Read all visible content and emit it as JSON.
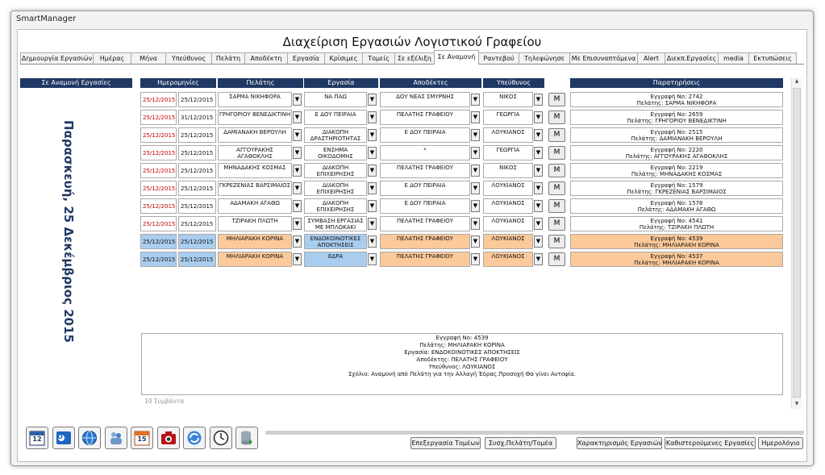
{
  "window": {
    "title": "SmartManager"
  },
  "app_title": "Διαχείριση Εργασιών Λογιστικού Γραφείου",
  "tabs": [
    "Δημιουργία Εργασιών",
    "Ημέρας",
    "Μήνα",
    "Υπεύθυνος",
    "Πελάτη",
    "Αποδέκτη",
    "Εργασία",
    "Κρίσιμες",
    "Τομείς",
    "Σε εξέλιξη",
    "Σε Αναμονή",
    "Ραντεβού",
    "Τηλεφώνησε",
    "Με Επισυναπτόμενα",
    "Alert",
    "Διεκπ.Εργασίες",
    "media",
    "Εκτυπώσεις"
  ],
  "active_tab": "Σε Αναμονή",
  "side": {
    "header": "Σε Αναμονή Εργασίες",
    "date": "Παρασκευή, 25 Δεκέμβριος 2015"
  },
  "headers": {
    "dates": "Ημερομηνίες",
    "customer": "Πελάτης",
    "task": "Εργασία",
    "recipients": "Αποδέκτες",
    "responsible": "Υπεύθυνος",
    "notes": "Παρατηρήσεις"
  },
  "m_label": "M",
  "rows": [
    {
      "d1": "25/12/2015",
      "d2": "25/12/2015",
      "customer": "ΣΑΡΜΑ ΝΙΚΗΦΟΡΑ",
      "task": "ΝΑ ΠΑΩ",
      "recipient": "ΔΟΥ ΝΕΑΣ ΣΜΥΡΝΗΣ",
      "responsible": "ΝΙΚΟΣ",
      "note1": "Εγγραφή Νο: 2742",
      "note2": "Πελάτης: ΣΑΡΜΑ ΝΙΚΗΦΟΡΑ",
      "d1_red": true,
      "selected": false
    },
    {
      "d1": "25/12/2015",
      "d2": "31/12/2015",
      "customer": "ΓΡΗΓΟΡΙΟΥ ΒΕΝΕΔΙΚΤΙΝΗ",
      "task": "Ε ΔΟΥ ΠΕΙΡΑΙΑ",
      "recipient": "ΠΕΛΑΤΗΣ ΓΡΑΦΕΙΟΥ",
      "responsible": "ΓΕΩΡΓΙΑ",
      "note1": "Εγγραφή Νο: 2659",
      "note2": "Πελάτης: ΓΡΗΓΟΡΙΟΥ ΒΕΝΕΔΙΚΤΙΝΗ",
      "d1_red": true,
      "selected": false
    },
    {
      "d1": "25/12/2015",
      "d2": "25/12/2015",
      "customer": "ΔΑΜΙΑΝΑΚΗ ΒΕΡΟΥΛΗ",
      "task": "ΔΙΑΚΟΠΗ ΔΡΑΣΤΗΡΙΟΤΗΤΑΣ",
      "recipient": "Ε ΔΟΥ ΠΕΙΡΑΙΑ",
      "responsible": "ΛΟΥΚΙΑΝΟΣ",
      "note1": "Εγγραφή Νο: 2515",
      "note2": "Πελάτης: ΔΑΜΙΑΝΑΚΗ ΒΕΡΟΥΛΗ",
      "d1_red": true,
      "selected": false
    },
    {
      "d1": "25/12/2015",
      "d2": "25/12/2015",
      "customer": "ΑΓΓΟΥΡΑΚΗΣ ΑΓΑΘΟΚΛΗΣ",
      "task": "ΕΝΣΗΜΑ ΟΙΚΟΔΟΜΗΣ",
      "recipient": "*",
      "responsible": "ΓΕΩΡΓΙΑ",
      "note1": "Εγγραφή Νο: 2220",
      "note2": "Πελάτης: ΑΓΓΟΥΡΑΚΗΣ ΑΓΑΘΟΚΛΗΣ",
      "d1_red": true,
      "selected": false
    },
    {
      "d1": "25/12/2015",
      "d2": "25/12/2015",
      "customer": "ΜΗΝΑΔΑΚΗΣ ΚΟΣΜΑΣ",
      "task": "ΔΙΑΚΟΠΗ ΕΠΙΧΕΙΡΗΣΗΣ",
      "recipient": "ΠΕΛΑΤΗΣ ΓΡΑΦΕΙΟΥ",
      "responsible": "ΝΙΚΟΣ",
      "note1": "Εγγραφή Νο: 2219",
      "note2": "Πελάτης: ΜΗΝΑΔΑΚΗΣ ΚΟΣΜΑΣ",
      "d1_red": true,
      "selected": false
    },
    {
      "d1": "25/12/2015",
      "d2": "25/12/2015",
      "customer": "ΓΚΡΕΖΕΝΙΑΣ ΒΑΡΣΙΜΑΙΟΣ",
      "task": "ΔΙΑΚΟΠΗ ΕΠΙΧΕΙΡΗΣΗΣ",
      "recipient": "Ε ΔΟΥ ΠΕΙΡΑΙΑ",
      "responsible": "ΛΟΥΚΙΑΝΟΣ",
      "note1": "Εγγραφή Νο: 1579",
      "note2": "Πελάτης: ΓΚΡΕΖΕΝΙΑΣ ΒΑΡΣΙΜΑΙΟΣ",
      "d1_red": true,
      "selected": false
    },
    {
      "d1": "25/12/2015",
      "d2": "25/12/2015",
      "customer": "ΑΔΑΜΑΚΗ ΑΓΑΘΩ",
      "task": "ΔΙΑΚΟΠΗ ΕΠΙΧΕΙΡΗΣΗΣ",
      "recipient": "Ε ΔΟΥ ΠΕΙΡΑΙΑ",
      "responsible": "ΛΟΥΚΙΑΝΟΣ",
      "note1": "Εγγραφή Νο: 1578",
      "note2": "Πελάτης: ΑΔΑΜΑΚΗ ΑΓΑΘΩ",
      "d1_red": true,
      "selected": false
    },
    {
      "d1": "25/12/2015",
      "d2": "25/12/2015",
      "customer": "ΤΖΙΡΑΚΗ ΠΛΩΤΗ",
      "task": "ΣΥΜΒΑΣΗ ΕΡΓΑΣΙΑΣ ΜΕ ΜΠΛΟΚΑΚΙ",
      "recipient": "ΠΕΛΑΤΗΣ ΓΡΑΦΕΙΟΥ",
      "responsible": "ΛΟΥΚΙΑΝΟΣ",
      "note1": "Εγγραφή Νο: 4541",
      "note2": "Πελάτης: ΤΖΙΡΑΚΗ ΠΛΩΤΗ",
      "d1_red": true,
      "selected": false
    },
    {
      "d1": "25/12/2015",
      "d2": "25/12/2015",
      "customer": "ΜΗΛΙΑΡΑΚΗ ΚΟΡΙΝΑ",
      "task": "ΕΝΔΟΚΟΙΝΟΤΙΚΕΣ ΑΠΟΚΤΗΣΕΙΣ",
      "recipient": "ΠΕΛΑΤΗΣ ΓΡΑΦΕΙΟΥ",
      "responsible": "ΛΟΥΚΙΑΝΟΣ",
      "note1": "Εγγραφή Νο: 4539",
      "note2": "Πελάτης: ΜΗΛΙΑΡΑΚΗ ΚΟΡΙΝΑ",
      "d1_red": false,
      "selected": true
    },
    {
      "d1": "25/12/2015",
      "d2": "25/12/2015",
      "customer": "ΜΗΛΙΑΡΑΚΗ ΚΟΡΙΝΑ",
      "task": "ΕΔΡΑ",
      "recipient": "ΠΕΛΑΤΗΣ ΓΡΑΦΕΙΟΥ",
      "responsible": "ΛΟΥΚΙΑΝΟΣ",
      "note1": "Εγγραφή Νο: 4537",
      "note2": "Πελάτης: ΜΗΛΙΑΡΑΚΗ ΚΟΡΙΝΑ",
      "d1_red": false,
      "selected": true
    }
  ],
  "detail": {
    "lines": [
      "Εγγραφή Νο: 4539",
      "Πελάτης: ΜΗΛΙΑΡΑΚΗ ΚΟΡΙΝΑ",
      "Εργασία: ΕΝΔΟΚΟΙΝΟΤΙΚΕΣ ΑΠΟΚΤΗΣΕΙΣ",
      "Αποδέκτης: ΠΕΛΑΤΗΣ ΓΡΑΦΕΙΟΥ",
      "Υπεύθυνος: ΛΟΥΚΙΑΝΟΣ",
      "Σχόλιο: Αναμονή από Πελάτη για την Αλλαγή Έδρας.Προσοχή Θα γίνει Αυτοψία."
    ]
  },
  "count_text": "10 Συμβάντα",
  "toolbar_icons": [
    {
      "name": "calendar-icon",
      "label": "12"
    },
    {
      "name": "outlook-icon",
      "label": "O"
    },
    {
      "name": "globe-icon",
      "label": ""
    },
    {
      "name": "users-icon",
      "label": ""
    },
    {
      "name": "date-15-icon",
      "label": "15"
    },
    {
      "name": "camera-icon",
      "label": ""
    },
    {
      "name": "refresh-icon",
      "label": ""
    },
    {
      "name": "clock-icon",
      "label": ""
    },
    {
      "name": "database-icon",
      "label": ""
    }
  ],
  "buttons": {
    "edit_sectors": "Επεξεργασία Τομέων",
    "link_customer_sector": "Συσχ.Πελάτη/Τομέα",
    "task_characterization": "Χαρακτηρισμός Εργασιών",
    "preset_tasks": "Καθιστερούμενες Εργασίες",
    "calendar": "Ημερολόγιο"
  },
  "colors": {
    "header_bg": "#1f3864",
    "sel_blue": "#a9cdef",
    "sel_orange": "#fbc99a",
    "date_red": "#c00000"
  }
}
